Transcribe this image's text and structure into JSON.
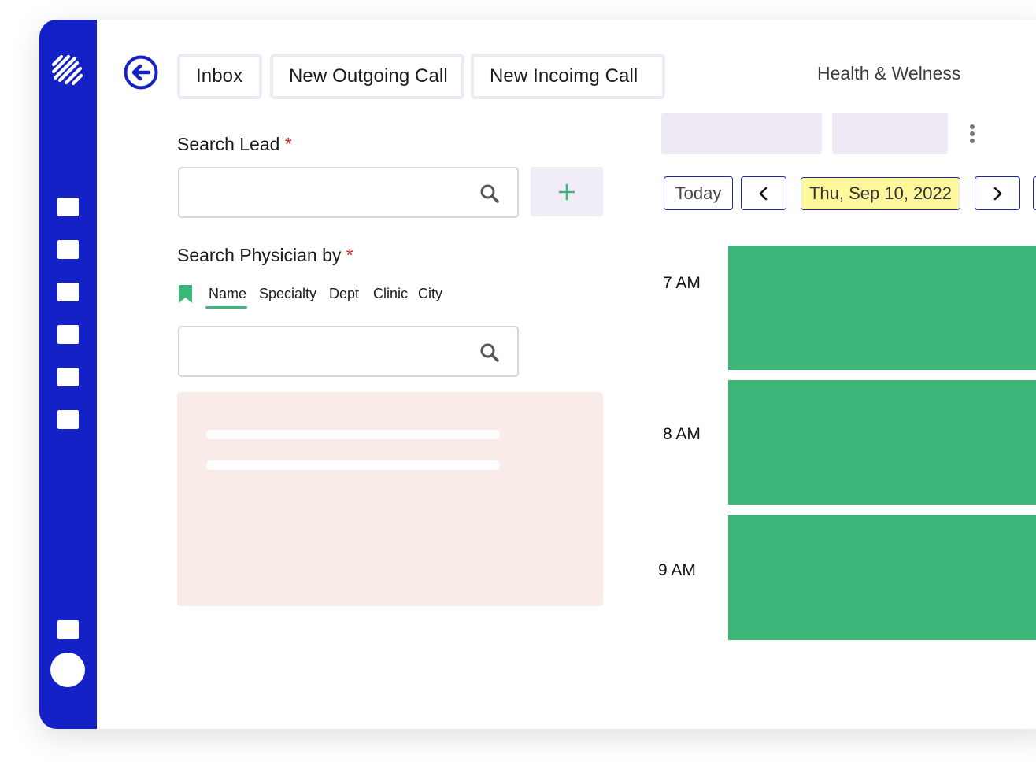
{
  "tabs": [
    {
      "label": "Inbox"
    },
    {
      "label": "New Outgoing Call"
    },
    {
      "label": "New Incoimg Call"
    }
  ],
  "brand": {
    "title": "Health & Welness"
  },
  "lead": {
    "label": "Search Lead",
    "required_mark": "*",
    "value": "",
    "placeholder": ""
  },
  "physician": {
    "label": "Search Physician by",
    "required_mark": "*",
    "filters": [
      "Name",
      "Specialty",
      "Dept",
      "Clinic",
      "City"
    ],
    "active_filter": "Name",
    "value": "",
    "placeholder": ""
  },
  "calendar": {
    "today_label": "Today",
    "date": "Thu, Sep 10, 2022",
    "times": [
      "7 AM",
      "8 AM",
      "9 AM"
    ]
  },
  "colors": {
    "sidebar": "#1421c6",
    "accent_green": "#3db779",
    "date_highlight": "#fdf69b",
    "required": "#d21f1f"
  },
  "icons": {
    "back": "arrow-left-circle-icon",
    "search": "magnifier-icon",
    "add": "plus-icon",
    "bookmark": "bookmark-icon",
    "more": "kebab-vertical-icon",
    "prev": "chevron-left-icon",
    "next": "chevron-right-icon"
  }
}
